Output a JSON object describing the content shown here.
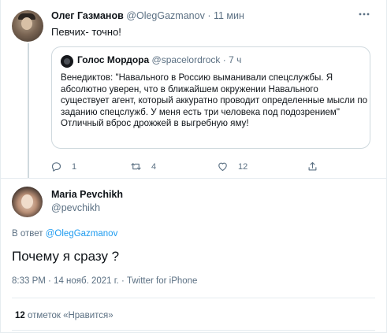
{
  "parent_tweet": {
    "author_name": "Олег Газманов",
    "author_handle": "@OlegGazmanov",
    "separator": "·",
    "time": "11 мин",
    "text": "Певчих- точно!",
    "more_icon": "more-horizontal-icon",
    "quoted": {
      "author_name": "Голос Мордора",
      "author_handle": "@spacelordrock",
      "separator": "·",
      "time": "7 ч",
      "text": "Венедиктов: \"Навального в Россию выманивали спецслужбы. Я абсолютно уверен, что в ближайшем окружении Навального существует агент, который аккуратно проводит определенные мысли по заданию спецслужб. У меня есть три человека под подозрением\"\nОтличный вброс дрожжей в выгребную яму!"
    },
    "actions": {
      "reply_count": "1",
      "retweet_count": "4",
      "like_count": "12"
    }
  },
  "main_tweet": {
    "author_name": "Maria Pevchikh",
    "author_handle": "@pevchikh",
    "reply_prefix": "В ответ",
    "reply_to": "@OlegGazmanov",
    "text": "Почему я сразу ?",
    "meta": "8:33 PM · 14 нояб. 2021 г. · Twitter for iPhone",
    "likes_count": "12",
    "likes_label": "отметок «Нравится»"
  },
  "colors": {
    "accent": "#1d9bf0",
    "secondary_text": "#5b7083",
    "border": "#e6ecf0"
  }
}
